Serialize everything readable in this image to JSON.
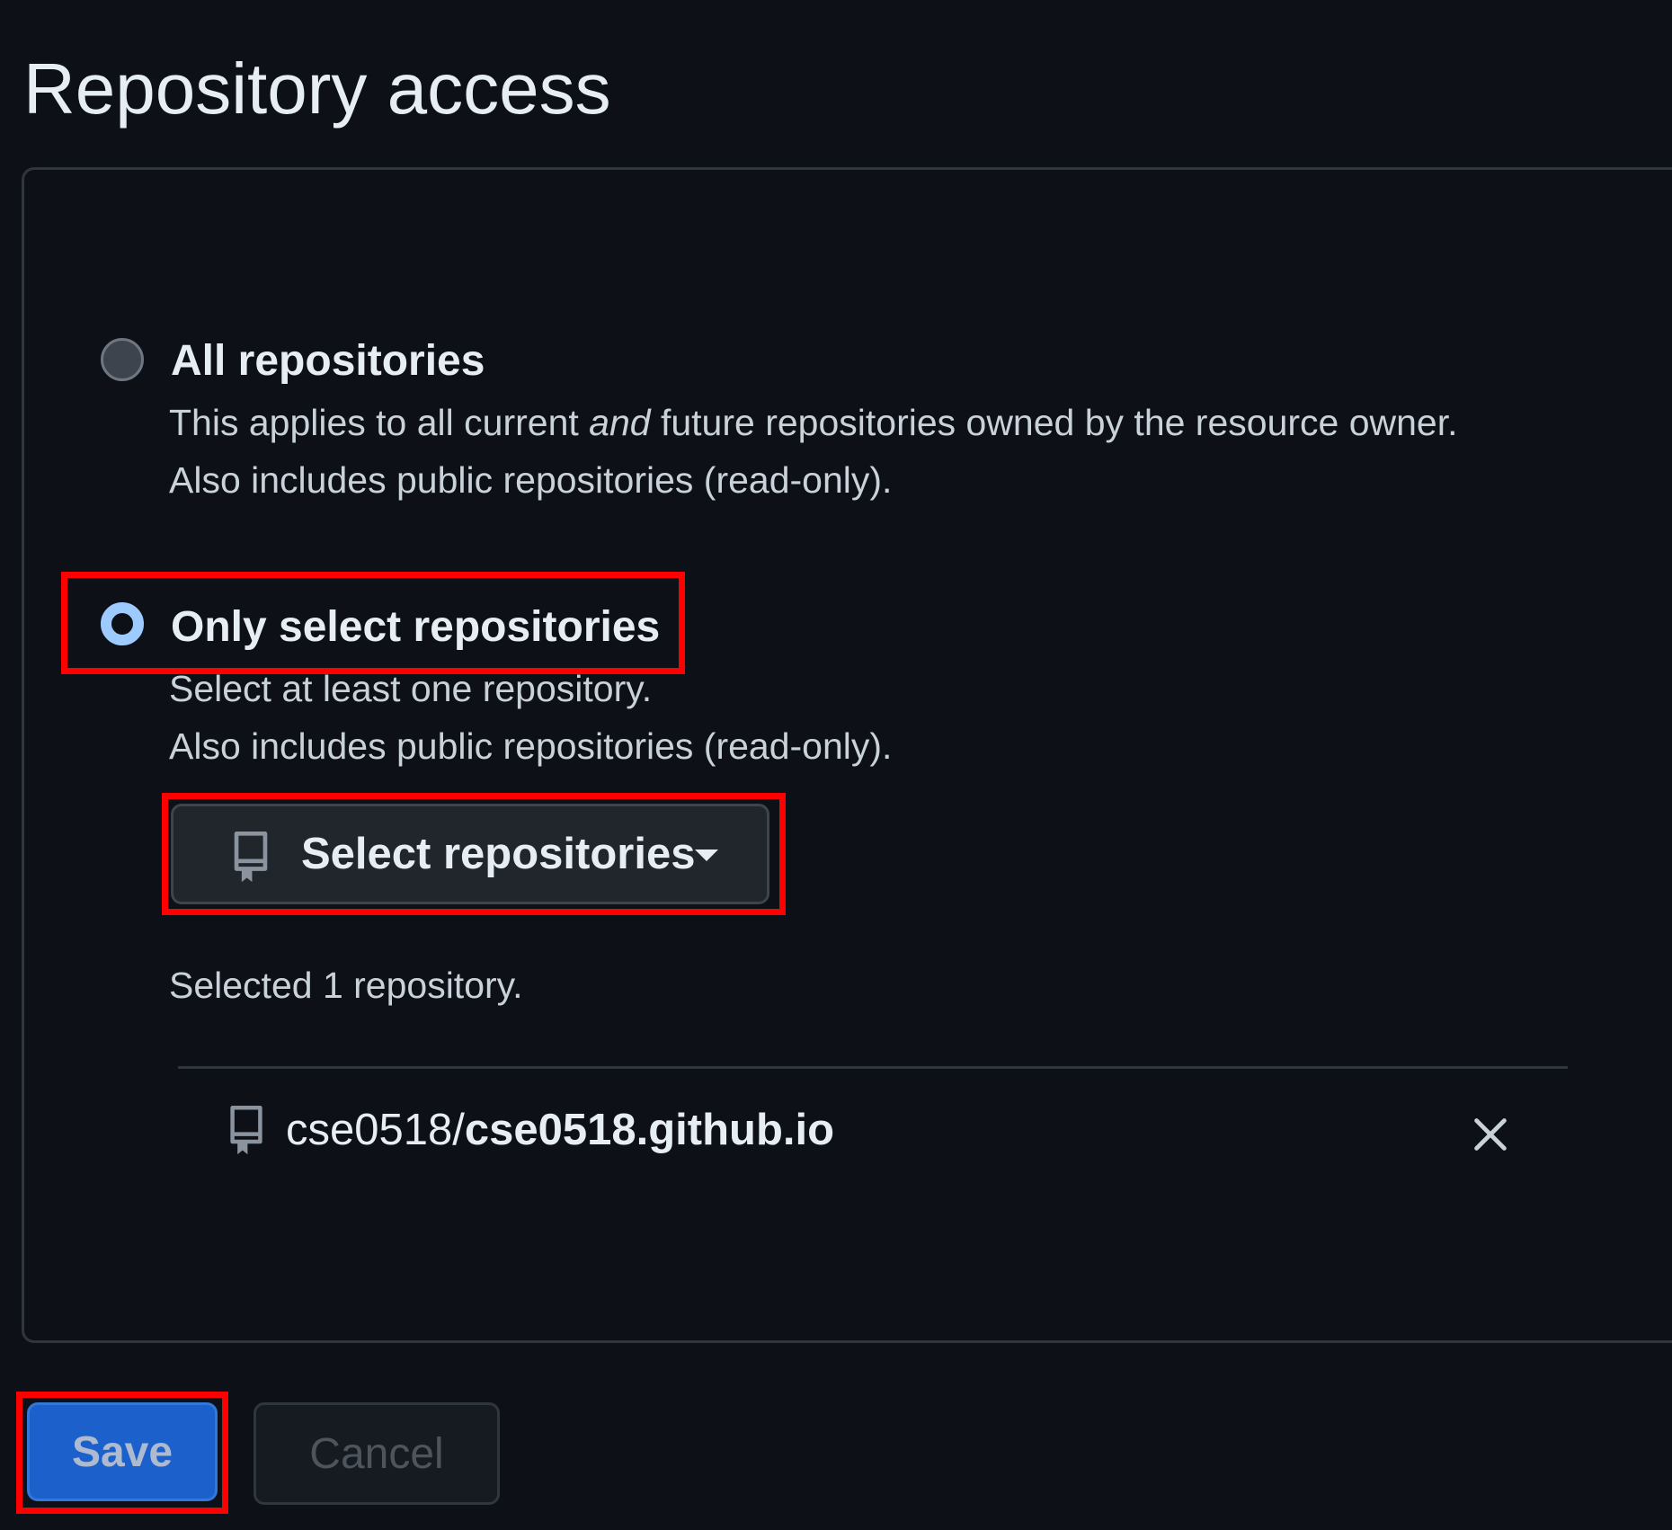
{
  "page": {
    "title": "Repository access"
  },
  "options": [
    {
      "title": "All repositories",
      "selected": false,
      "desc_line1_before": "This applies to all current ",
      "desc_line1_emphasis": "and",
      "desc_line1_after": " future repositories owned by the resource owner.",
      "desc_line2": "Also includes public repositories (read-only)."
    },
    {
      "title": "Only select repositories",
      "selected": true,
      "desc_line1": "Select at least one repository.",
      "desc_line2": "Also includes public repositories (read-only)."
    }
  ],
  "select_button": {
    "label": "Select repositories",
    "icon": "repo-icon"
  },
  "selection": {
    "count_text": "Selected 1 repository.",
    "repos": [
      {
        "owner": "cse0518/",
        "name": "cse0518.github.io",
        "icon": "repo-icon",
        "remove_icon": "close-icon"
      }
    ]
  },
  "actions": {
    "save_label": "Save",
    "cancel_label": "Cancel"
  },
  "colors": {
    "background": "#0d1117",
    "accent": "#1f6feb",
    "radio_checked": "#9ecbff",
    "highlight": "#ff0000"
  }
}
